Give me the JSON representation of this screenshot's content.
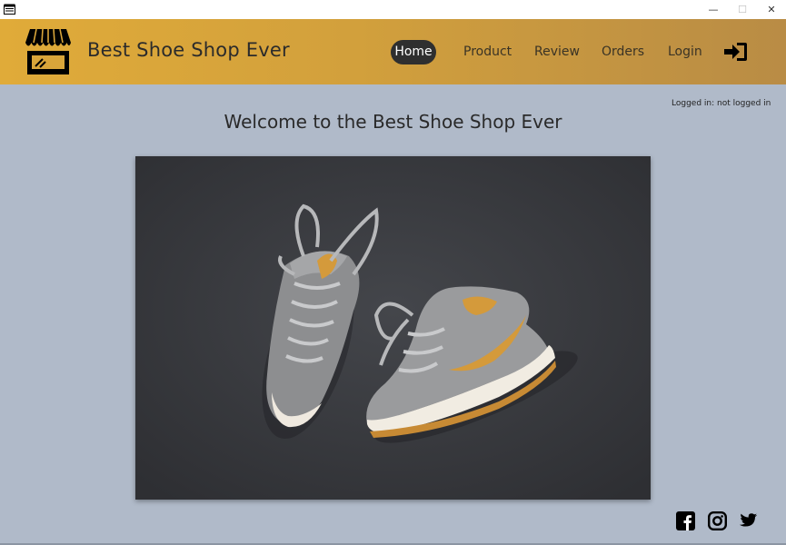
{
  "window": {
    "minimize_glyph": "—",
    "maximize_glyph": "☐",
    "close_glyph": "✕"
  },
  "header": {
    "brand": "Best Shoe Shop Ever",
    "logo_icon": "storefront-icon",
    "nav": [
      {
        "label": "Home",
        "active": true
      },
      {
        "label": "Product",
        "active": false
      },
      {
        "label": "Review",
        "active": false
      },
      {
        "label": "Orders",
        "active": false
      },
      {
        "label": "Login",
        "active": false
      }
    ],
    "login_icon": "sign-in-icon"
  },
  "main": {
    "login_status": "Logged in: not logged in",
    "welcome": "Welcome to the Best Shoe Shop Ever",
    "hero_image": "sneakers-photo"
  },
  "footer": {
    "social": [
      "facebook-icon",
      "instagram-icon",
      "twitter-icon"
    ]
  },
  "colors": {
    "header_start": "#e0ab39",
    "header_end": "#b98c45",
    "page_bg": "#b0bac9",
    "active_nav_bg": "#2f2f2f"
  }
}
